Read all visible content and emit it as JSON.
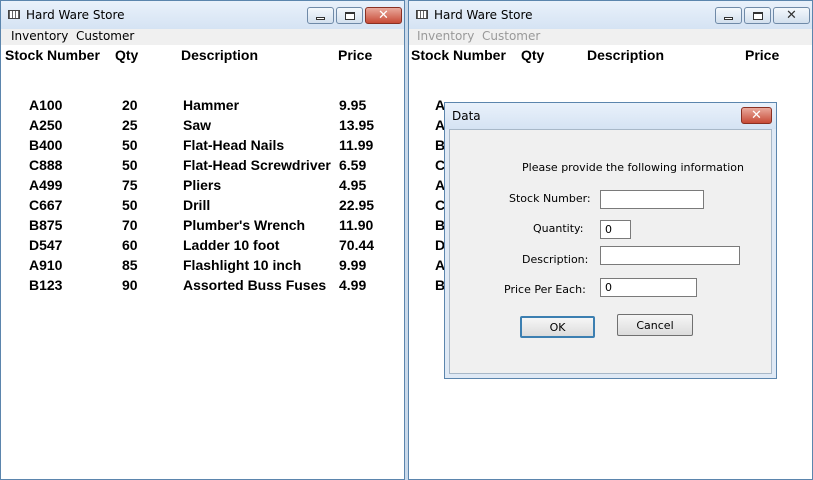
{
  "left_window": {
    "title": "Hard Ware Store",
    "menu": [
      "Inventory",
      "Customer"
    ],
    "headers": [
      "Stock Number",
      "Qty",
      "Description",
      "Price"
    ],
    "rows": [
      {
        "stock": "A100",
        "qty": "20",
        "desc": "Hammer",
        "price": "9.95"
      },
      {
        "stock": "A250",
        "qty": "25",
        "desc": "Saw",
        "price": "13.95"
      },
      {
        "stock": "B400",
        "qty": "50",
        "desc": "Flat-Head Nails",
        "price": "11.99"
      },
      {
        "stock": "C888",
        "qty": "50",
        "desc": "Flat-Head Screwdriver",
        "price": "6.59"
      },
      {
        "stock": "A499",
        "qty": "75",
        "desc": "Pliers",
        "price": "4.95"
      },
      {
        "stock": "C667",
        "qty": "50",
        "desc": "Drill",
        "price": "22.95"
      },
      {
        "stock": "B875",
        "qty": "70",
        "desc": "Plumber's Wrench",
        "price": "11.90"
      },
      {
        "stock": "D547",
        "qty": "60",
        "desc": "Ladder 10 foot",
        "price": "70.44"
      },
      {
        "stock": "A910",
        "qty": "85",
        "desc": "Flashlight 10 inch",
        "price": "9.99"
      },
      {
        "stock": "B123",
        "qty": "90",
        "desc": "Assorted Buss Fuses",
        "price": "4.99"
      }
    ]
  },
  "right_window": {
    "title": "Hard Ware Store",
    "menu": [
      "Inventory",
      "Customer"
    ],
    "headers": [
      "Stock Number",
      "Qty",
      "Description",
      "Price"
    ],
    "partial_rows": [
      "A",
      "A",
      "B",
      "C",
      "A",
      "C",
      "B",
      "D",
      "A",
      "B"
    ]
  },
  "dialog": {
    "title": "Data",
    "prompt": "Please provide the following information",
    "stock_label": "Stock Number:",
    "stock_value": "",
    "quantity_label": "Quantity:",
    "quantity_value": "0",
    "description_label": "Description:",
    "description_value": "",
    "price_label": "Price Per Each:",
    "price_value": "0",
    "ok_label": "OK",
    "cancel_label": "Cancel"
  },
  "icons": {
    "close": "close-icon",
    "minimize": "minimize-icon",
    "maximize": "maximize-icon",
    "app": "app-icon"
  },
  "colors": {
    "close_button": "#c74a36",
    "frame": "#dfe9f5",
    "border": "#5b85ad"
  }
}
